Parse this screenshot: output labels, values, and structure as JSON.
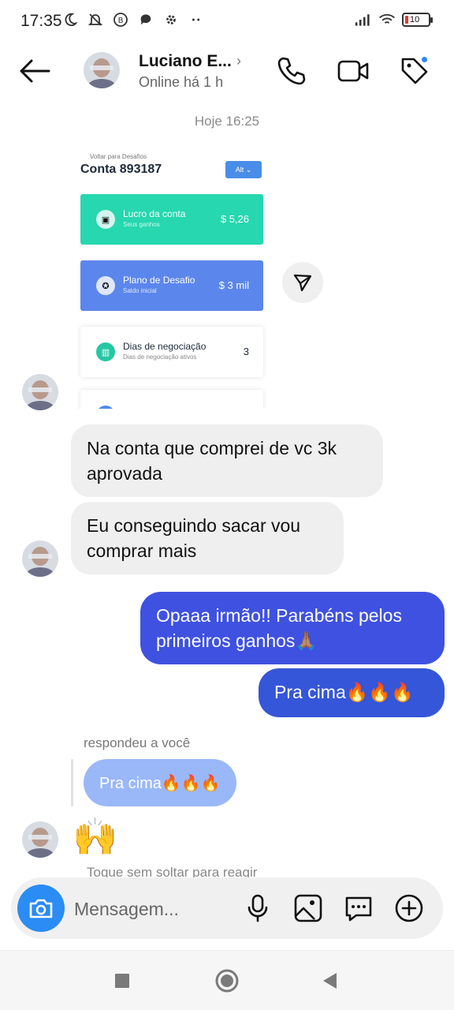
{
  "status_bar": {
    "time": "17:35",
    "battery": "10"
  },
  "header": {
    "name": "Luciano E...",
    "status": "Online há 1 h"
  },
  "day_stamp": "Hoje 16:25",
  "shared_image": {
    "back_text": "Voltar para Desafios",
    "title": "Conta 893187",
    "alt_button": "Alt",
    "cards": [
      {
        "label": "Lucro da conta",
        "sub": "Seus ganhos",
        "value": "$ 5,26",
        "color": "#26d7b0"
      },
      {
        "label": "Plano de Desafio",
        "sub": "Saldo inicial",
        "value": "$ 3 mil",
        "color": "#5b86ec"
      },
      {
        "label": "Dias de negociação",
        "sub": "Dias de negociação ativos",
        "value": "3",
        "color": "#ffffff"
      }
    ]
  },
  "messages": {
    "in_1": "Na conta que comprei de vc 3k aprovada",
    "in_2": "Eu conseguindo sacar vou comprar mais",
    "out_1": "Opaaa irmão!! Parabéns pelos primeiros ganhos🙏🏽",
    "out_2": "Pra cima🔥🔥🔥",
    "reply_label": "respondeu a você",
    "reply_quote": "Pra cima🔥🔥🔥",
    "emoji_reply": "🙌",
    "hint": "Toque sem soltar para reagir"
  },
  "composer": {
    "placeholder": "Mensagem..."
  },
  "icons": {
    "back": "arrow-left-icon",
    "call": "phone-icon",
    "video": "video-camera-icon",
    "tag": "tag-icon",
    "camera": "camera-icon",
    "mic": "microphone-icon",
    "gallery": "image-icon",
    "sticker": "chat-bubble-icon",
    "plus": "plus-circle-icon"
  },
  "colors": {
    "outgoing": "#3f51e0",
    "incoming": "#efefef",
    "camera_button": "#2a8cf4",
    "reply_bubble": "#9ab8f7"
  }
}
